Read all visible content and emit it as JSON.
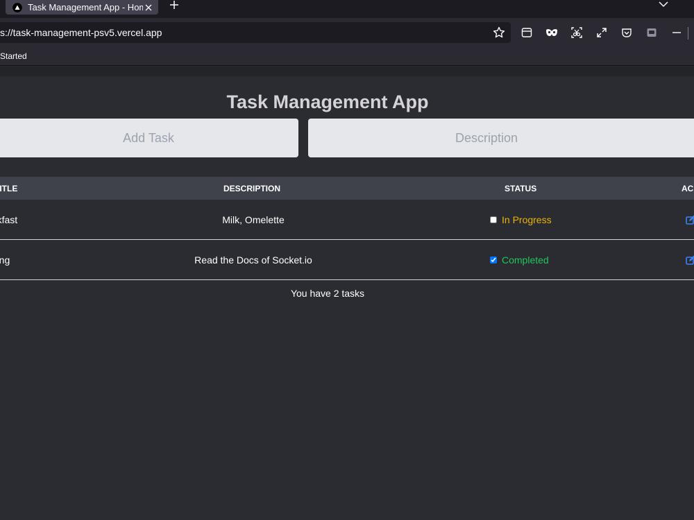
{
  "browser": {
    "tab_title": "Task Management App - Home",
    "url": "s://task-management-psv5.vercel.app",
    "bookmark": "Started"
  },
  "app": {
    "title": "Task Management App",
    "task_placeholder": "Add Task",
    "description_placeholder": "Description"
  },
  "table": {
    "headers": {
      "title": "TITLE",
      "description": "DESCRIPTION",
      "status": "STATUS",
      "actions": "AC"
    },
    "rows": [
      {
        "title": "eakfast",
        "description": "Milk, Omelette",
        "status": "In Progress",
        "checked": false
      },
      {
        "title": "oding",
        "description": "Read the Docs of Socket.io",
        "status": "Completed",
        "checked": true
      }
    ]
  },
  "footer": {
    "task_count": "You have 2 tasks"
  },
  "colors": {
    "in_progress": "#eab308",
    "completed": "#22c55e",
    "edit_icon": "#3b82f6"
  }
}
